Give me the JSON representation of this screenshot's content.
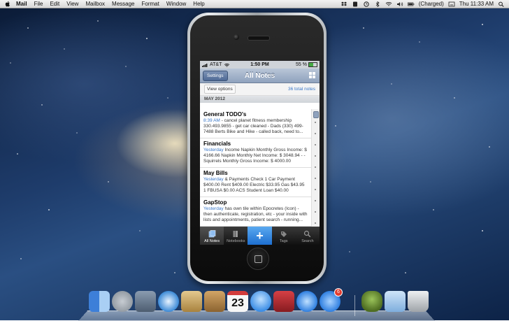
{
  "menubar": {
    "app_name": "Mail",
    "items": [
      "File",
      "Edit",
      "View",
      "Mailbox",
      "Message",
      "Format",
      "Window",
      "Help"
    ],
    "battery_status": "(Charged)",
    "clock": "Thu 11:33 AM"
  },
  "phone": {
    "status": {
      "carrier": "AT&T",
      "time": "1:50 PM",
      "battery": "55 %",
      "battery_level": 0.55
    },
    "nav": {
      "settings_label": "Settings",
      "title": "All Notes"
    },
    "view_options_label": "View options",
    "total_notes": "36 total notes",
    "section": "MAY 2012",
    "notes": [
      {
        "title": "General TODO's",
        "when": "8:39 AM",
        "body": " - cancel planet fitness membership 330.493.9855 - get car cleaned - Dads (330) 499-7488 Berts Bike and Hike - called back, need to..."
      },
      {
        "title": "Financials",
        "when": "Yesterday",
        "body": " Income Napkin Monthly Gross Income: $ 4166.66 Napkin Monthly Net Income: $ 3048.94 - - Squirrels Monthly Gross Income: $ 4000.00 Squirrels..."
      },
      {
        "title": "May Bills",
        "when": "Yesterday",
        "body": " & Payments Check 1 Car Payment $400.00 Rent $409.00 Electric $33.95 Gas $43.95 1 FBUSA $0.00 ACS Student Loan $40.00 SALLIE..."
      },
      {
        "title": "GapStop",
        "when": "Yesterday",
        "body": " has own tile within Epocretes (Icon) - then authenticate, registration, etc - your inside with lists and appointments, patient search - running..."
      }
    ],
    "tabs": [
      {
        "label": "All Notes",
        "icon": "notes-icon"
      },
      {
        "label": "Notebooks",
        "icon": "notebooks-icon"
      },
      {
        "label": "",
        "icon": "plus-icon"
      },
      {
        "label": "Tags",
        "icon": "tag-icon"
      },
      {
        "label": "Search",
        "icon": "search-icon"
      }
    ]
  },
  "dock": {
    "items": [
      {
        "name": "finder",
        "color": "#4a8fe0"
      },
      {
        "name": "launchpad",
        "color": "#9aa3ad"
      },
      {
        "name": "mission-control",
        "color": "#6a7b8c"
      },
      {
        "name": "safari",
        "color": "#3c8ad6"
      },
      {
        "name": "preview",
        "color": "#c9a86b"
      },
      {
        "name": "address-book",
        "color": "#b98c50"
      },
      {
        "name": "calendar",
        "color": "#f4f4f4"
      },
      {
        "name": "messages",
        "color": "#5aa9f0"
      },
      {
        "name": "photo-booth",
        "color": "#b3282d"
      },
      {
        "name": "itunes",
        "color": "#2f7fe0"
      },
      {
        "name": "app-store",
        "color": "#3b8de8"
      },
      {
        "name": "automator",
        "color": "#6c8e3a"
      },
      {
        "name": "downloads-folder",
        "color": "#8fbde8"
      },
      {
        "name": "trash",
        "color": "#c5c9cd"
      }
    ],
    "calendar_day": "23",
    "app_store_badge": "6"
  }
}
